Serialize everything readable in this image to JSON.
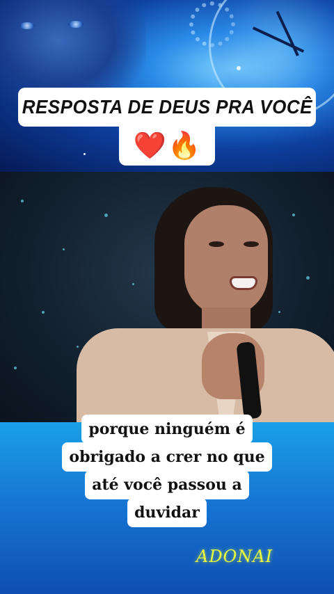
{
  "banner": {
    "title": "RESPOSTA DE DEUS PRA VOCÊ",
    "emojis": [
      "❤️",
      "🔥"
    ]
  },
  "caption": {
    "lines": [
      "porque ninguém é",
      "obrigado a crer no que",
      "até você passou a",
      "duvidar"
    ]
  },
  "watermark": "ADONAI",
  "colors": {
    "title_bg": "#ffffff",
    "caption_bg": "#ffffff",
    "watermark": "#e9ff3c",
    "bottom_gradient": [
      "#1aa0e6",
      "#0f4eb3"
    ]
  }
}
